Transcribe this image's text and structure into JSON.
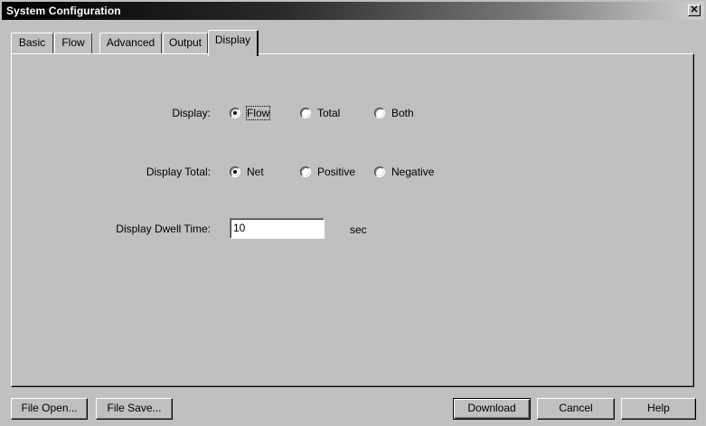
{
  "window": {
    "title": "System Configuration",
    "close_glyph": "✕"
  },
  "tabs": [
    {
      "label": "Basic"
    },
    {
      "label": "Flow"
    },
    {
      "label": "Advanced"
    },
    {
      "label": "Output"
    },
    {
      "label": "Display",
      "active": true
    }
  ],
  "display": {
    "label": "Display:",
    "options": [
      "Flow",
      "Total",
      "Both"
    ],
    "selected": "Flow"
  },
  "display_total": {
    "label": "Display Total:",
    "options": [
      "Net",
      "Positive",
      "Negative"
    ],
    "selected": "Net"
  },
  "dwell": {
    "label": "Display Dwell Time:",
    "value": "10",
    "unit": "sec"
  },
  "buttons": {
    "file_open": "File Open...",
    "file_save": "File Save...",
    "download": "Download",
    "cancel": "Cancel",
    "help": "Help"
  }
}
